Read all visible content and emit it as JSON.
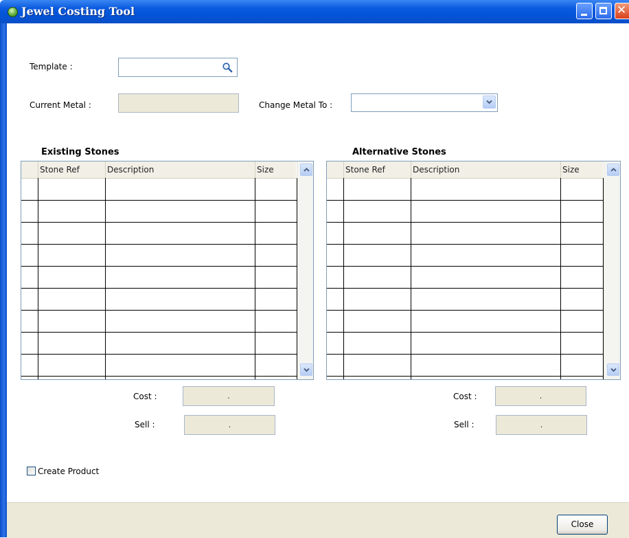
{
  "window": {
    "title": "Jewel Costing Tool",
    "app_icon": "app-globe-icon"
  },
  "form": {
    "template_label": "Template :",
    "template_value": "",
    "current_metal_label": "Current Metal :",
    "current_metal_value": "",
    "change_metal_label": "Change Metal To :",
    "change_metal_value": ""
  },
  "existing": {
    "title": "Existing Stones",
    "columns": [
      "Stone Ref",
      "Description",
      "Size"
    ],
    "cost_label": "Cost :",
    "cost_value": ".",
    "sell_label": "Sell :",
    "sell_value": "."
  },
  "alternative": {
    "title": "Alternative Stones",
    "columns": [
      "Stone Ref",
      "Description",
      "Size"
    ],
    "cost_label": "Cost :",
    "cost_value": ".",
    "sell_label": "Sell :",
    "sell_value": "."
  },
  "create_product": {
    "label": "Create Product",
    "checked": false
  },
  "footer": {
    "close_label": "Close"
  },
  "colors": {
    "titlebar": "#0a5be0",
    "client_bg": "#f1efe6",
    "readonly_bg": "#ece9d8",
    "border": "#7f9db9"
  }
}
